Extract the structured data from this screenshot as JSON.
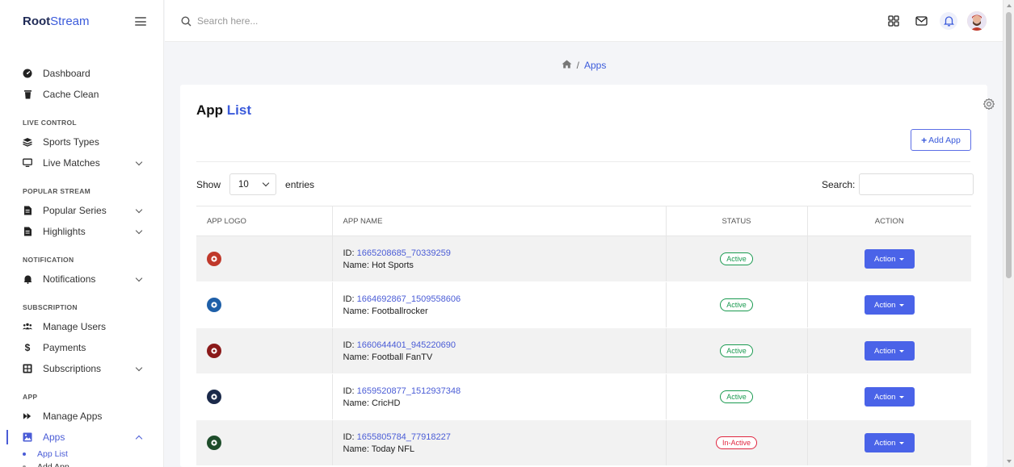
{
  "brand": {
    "bold": "Root",
    "light": "Stream"
  },
  "topbar": {
    "search_placeholder": "Search here..."
  },
  "sidebar": {
    "groups": [
      {
        "section": "",
        "items": [
          {
            "label": "Dashboard",
            "icon": "dashboard-icon"
          },
          {
            "label": "Cache Clean",
            "icon": "trash-icon"
          }
        ]
      },
      {
        "section": "LIVE CONTROL",
        "items": [
          {
            "label": "Sports Types",
            "icon": "layers-icon"
          },
          {
            "label": "Live Matches",
            "icon": "desktop-icon",
            "chevron": true
          }
        ]
      },
      {
        "section": "POPULAR STREAM",
        "items": [
          {
            "label": "Popular Series",
            "icon": "file-icon",
            "chevron": true
          },
          {
            "label": "Highlights",
            "icon": "file-icon",
            "chevron": true
          }
        ]
      },
      {
        "section": "NOTIFICATION",
        "items": [
          {
            "label": "Notifications",
            "icon": "bell-icon",
            "chevron": true
          }
        ]
      },
      {
        "section": "SUBSCRIPTION",
        "items": [
          {
            "label": "Manage Users",
            "icon": "users-icon"
          },
          {
            "label": "Payments",
            "icon": "dollar-icon"
          },
          {
            "label": "Subscriptions",
            "icon": "grid-icon",
            "chevron": true
          }
        ]
      },
      {
        "section": "APP",
        "items": [
          {
            "label": "Manage Apps",
            "icon": "forward-icon"
          },
          {
            "label": "Apps",
            "icon": "image-icon",
            "chevron": true,
            "active": true
          }
        ]
      }
    ],
    "subitems": [
      {
        "label": "App List",
        "active": true
      },
      {
        "label": "Add App",
        "active": false
      }
    ]
  },
  "breadcrumb": {
    "current": "Apps",
    "separator": "/"
  },
  "card": {
    "title_plain": "App",
    "title_highlight": "List",
    "add_button": "Add App"
  },
  "table_controls": {
    "show_label": "Show",
    "entries_value": "10",
    "entries_label": "entries",
    "search_label": "Search:"
  },
  "table": {
    "headers": [
      "APP LOGO",
      "APP NAME",
      "STATUS",
      "ACTION"
    ],
    "id_prefix": "ID:",
    "name_prefix": "Name:",
    "action_label": "Action",
    "rows": [
      {
        "id": "1665208685_70339259",
        "name": "Hot Sports",
        "status": "Active",
        "logo_color": "#c0392b"
      },
      {
        "id": "1664692867_1509558606",
        "name": "Footballrocker",
        "status": "Active",
        "logo_color": "#1e5fa8"
      },
      {
        "id": "1660644401_945220690",
        "name": "Football FanTV",
        "status": "Active",
        "logo_color": "#8b1a1a"
      },
      {
        "id": "1659520877_1512937348",
        "name": "CricHD",
        "status": "Active",
        "logo_color": "#1b2a4a"
      },
      {
        "id": "1655805784_77918227",
        "name": "Today NFL",
        "status": "In-Active",
        "logo_color": "#1e4d2b"
      }
    ]
  },
  "colors": {
    "accent": "#3b5bdb",
    "button": "#4a63e8",
    "active_status": "#1a9a50",
    "inactive_status": "#e0253f"
  }
}
